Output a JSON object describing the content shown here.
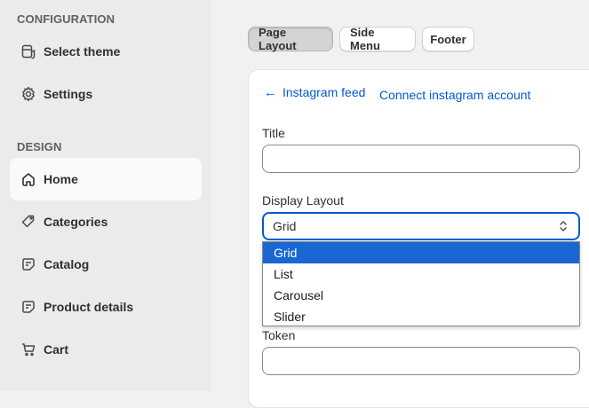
{
  "sidebar": {
    "configuration_heading": "CONFIGURATION",
    "config_items": [
      {
        "label": "Select theme",
        "icon": "theme-icon"
      },
      {
        "label": "Settings",
        "icon": "gear-icon"
      }
    ],
    "design_heading": "DESIGN",
    "design_items": [
      {
        "label": "Home",
        "icon": "home-icon",
        "active": true
      },
      {
        "label": "Categories",
        "icon": "tag-icon"
      },
      {
        "label": "Catalog",
        "icon": "catalog-icon"
      },
      {
        "label": "Product details",
        "icon": "product-icon"
      },
      {
        "label": "Cart",
        "icon": "cart-icon"
      }
    ]
  },
  "tabs": [
    {
      "label": "Page Layout",
      "active": true
    },
    {
      "label": "Side Menu"
    },
    {
      "label": "Footer"
    }
  ],
  "panel": {
    "back_label": "Instagram feed",
    "back_arrow": "←",
    "connect_label": "Connect instagram account",
    "title_label": "Title",
    "title_value": "",
    "display_layout_label": "Display Layout",
    "display_layout_value": "Grid",
    "display_layout_options": [
      "Grid",
      "List",
      "Carousel",
      "Slider"
    ],
    "token_label": "Token",
    "token_value": ""
  },
  "colors": {
    "accent": "#005bd3",
    "selected_option": "#1967d2",
    "sidebar_bg": "#ebebeb",
    "page_bg": "#f1f1f1"
  }
}
